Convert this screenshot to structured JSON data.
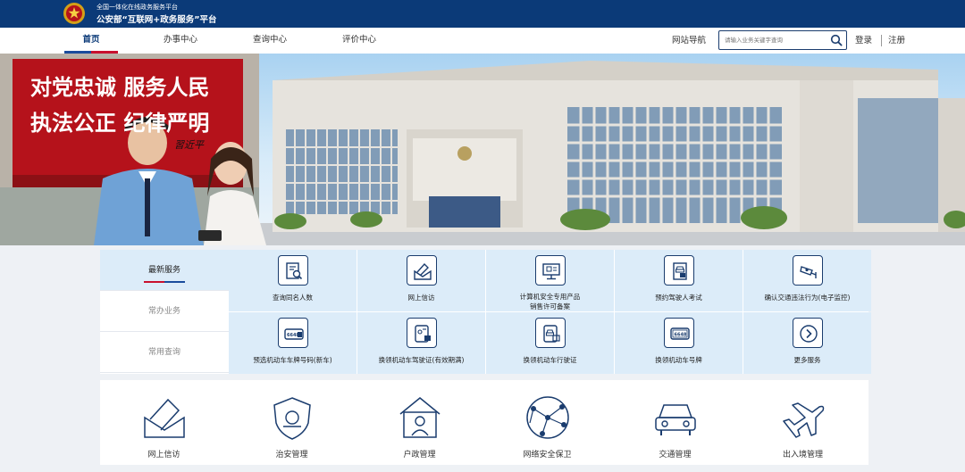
{
  "header": {
    "subtitle": "全国一体化在线政务服务平台",
    "title": "公安部“互联网+政务服务”平台"
  },
  "nav": {
    "items": [
      "首页",
      "办事中心",
      "查询中心",
      "评价中心"
    ],
    "site_nav": "网站导航",
    "search_placeholder": "请输入业务关键字查询",
    "login": "登录",
    "register": "注册"
  },
  "banner": {
    "motto_line1": "对党忠诚  服务人民",
    "motto_line2": "执法公正  纪律严明",
    "signature": "習近平"
  },
  "services": {
    "tabs": [
      "最新服务",
      "常办业务",
      "常用查询"
    ],
    "items": [
      {
        "label": "查询同名人数",
        "icon": "document-search-icon"
      },
      {
        "label": "网上信访",
        "icon": "envelope-pen-icon"
      },
      {
        "label": "计算机安全专用产品",
        "label2": "销售许可备案",
        "icon": "computer-monitor-icon"
      },
      {
        "label": "预约驾驶人考试",
        "icon": "driver-exam-icon"
      },
      {
        "label": "确认交通违法行为(电子监控)",
        "icon": "surveillance-camera-icon"
      },
      {
        "label": "预选机动车车牌号码(新车)",
        "icon": "license-plate-icon"
      },
      {
        "label": "换领机动车驾驶证(有效期满)",
        "icon": "driver-license-icon"
      },
      {
        "label": "换领机动车行驶证",
        "icon": "vehicle-license-icon"
      },
      {
        "label": "换领机动车号牌",
        "icon": "plate-icon"
      },
      {
        "label": "更多服务",
        "icon": "chevron-right-icon"
      }
    ]
  },
  "categories": [
    {
      "label": "网上信访",
      "icon": "envelope-icon"
    },
    {
      "label": "治安管理",
      "icon": "police-shield-icon"
    },
    {
      "label": "户政管理",
      "icon": "household-icon"
    },
    {
      "label": "网络安全保卫",
      "icon": "network-globe-icon"
    },
    {
      "label": "交通管理",
      "icon": "car-icon"
    },
    {
      "label": "出入境管理",
      "icon": "airplane-icon"
    }
  ],
  "colors": {
    "brand": "#0b3a78",
    "accent_red": "#c8102e",
    "service_bg": "#dcecf9"
  }
}
